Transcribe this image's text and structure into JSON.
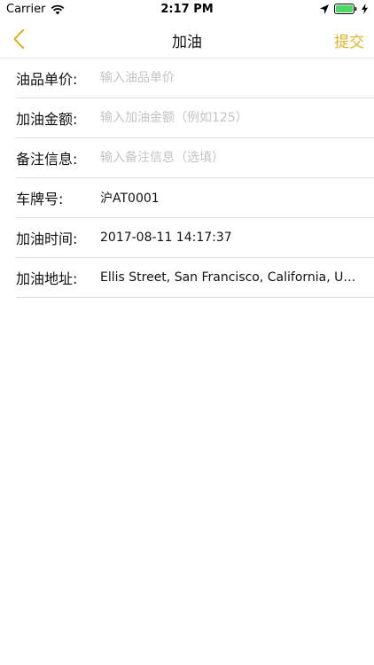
{
  "status_bar": {
    "carrier": "Carrier",
    "time": "2:17 PM",
    "icons": [
      "wifi-icon",
      "location-arrow-icon",
      "battery-icon",
      "charging-icon"
    ],
    "battery_color": "#4cd964"
  },
  "nav": {
    "title": "加油",
    "submit_label": "提交",
    "accent_color": "#e0b32a",
    "back_icon": "chevron-left-icon"
  },
  "form": {
    "unit_price": {
      "label": "油品单价:",
      "placeholder": "输入油品单价"
    },
    "amount": {
      "label": "加油金额:",
      "placeholder": "输入加油金额（例如125）"
    },
    "remarks": {
      "label": "备注信息:",
      "placeholder": "输入备注信息（选填）"
    },
    "plate": {
      "label": "车牌号:",
      "value": "沪AT0001"
    },
    "time": {
      "label": "加油时间:",
      "value": "2017-08-11 14:17:37"
    },
    "address": {
      "label": "加油地址:",
      "value": "Ellis Street, San Francisco, California, United States"
    }
  }
}
